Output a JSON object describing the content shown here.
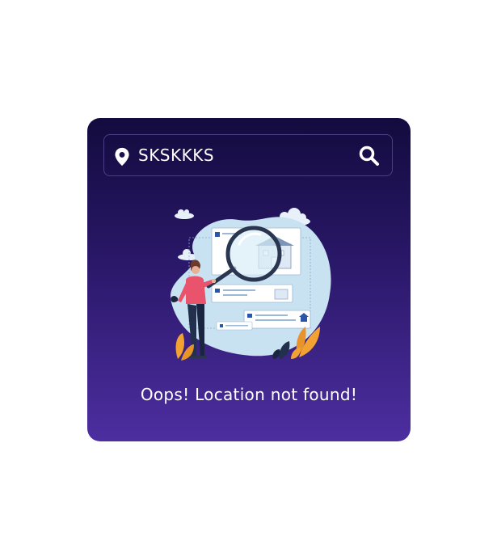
{
  "search": {
    "value": "SKSKKKS",
    "icon_left": "location-pin-icon",
    "icon_right": "search-icon"
  },
  "result": {
    "illustration": "not-found-illustration",
    "message": "Oops! Location not found!"
  },
  "colors": {
    "card_top": "#130b3e",
    "card_bottom": "#4d2ea0",
    "text": "#ffffff",
    "illustration_blob": "#c8e2f2"
  }
}
